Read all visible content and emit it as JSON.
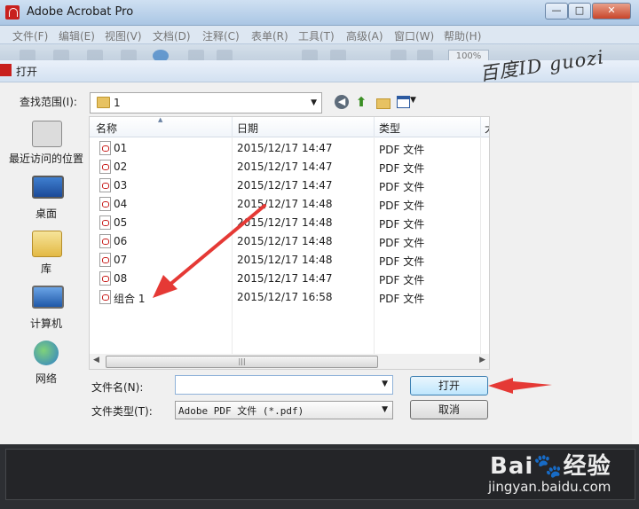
{
  "app": {
    "title": "Adobe Acrobat Pro",
    "window_buttons": {
      "minimize": "—",
      "maximize": "□",
      "close": "✕"
    },
    "menu": [
      "文件(F)",
      "编辑(E)",
      "视图(V)",
      "文档(D)",
      "注释(C)",
      "表单(R)",
      "工具(T)",
      "高级(A)",
      "窗口(W)",
      "帮助(H)"
    ],
    "toolbar_zoom": "100%"
  },
  "watermark": "百度ID guozi",
  "dialog": {
    "title": "打开",
    "look_in_label": "查找范围(I):",
    "look_in_value": "1",
    "places": [
      {
        "label": "最近访问的位置",
        "icon": "recent-places-icon"
      },
      {
        "label": "桌面",
        "icon": "desktop-icon"
      },
      {
        "label": "库",
        "icon": "library-icon"
      },
      {
        "label": "计算机",
        "icon": "computer-icon"
      },
      {
        "label": "网络",
        "icon": "network-icon"
      }
    ],
    "columns": [
      "名称",
      "日期",
      "类型",
      "大"
    ],
    "files": [
      {
        "name": "01",
        "date": "2015/12/17 14:47",
        "type": "PDF 文件"
      },
      {
        "name": "02",
        "date": "2015/12/17 14:47",
        "type": "PDF 文件"
      },
      {
        "name": "03",
        "date": "2015/12/17 14:47",
        "type": "PDF 文件"
      },
      {
        "name": "04",
        "date": "2015/12/17 14:48",
        "type": "PDF 文件"
      },
      {
        "name": "05",
        "date": "2015/12/17 14:48",
        "type": "PDF 文件"
      },
      {
        "name": "06",
        "date": "2015/12/17 14:48",
        "type": "PDF 文件"
      },
      {
        "name": "07",
        "date": "2015/12/17 14:48",
        "type": "PDF 文件"
      },
      {
        "name": "08",
        "date": "2015/12/17 14:47",
        "type": "PDF 文件"
      },
      {
        "name": "组合 1",
        "date": "2015/12/17 16:58",
        "type": "PDF 文件"
      }
    ],
    "filename_label": "文件名(N):",
    "filename_value": "",
    "filetype_label": "文件类型(T):",
    "filetype_value": "Adobe PDF 文件 (*.pdf)",
    "open_button": "打开",
    "cancel_button": "取消"
  },
  "baidu": {
    "logo": "Bai🐾经验",
    "url": "jingyan.baidu.com"
  },
  "colors": {
    "annotation_arrow": "#e53935",
    "dialog_bg": "#f0f0f0",
    "title_gradient": "#cfe0f2"
  }
}
